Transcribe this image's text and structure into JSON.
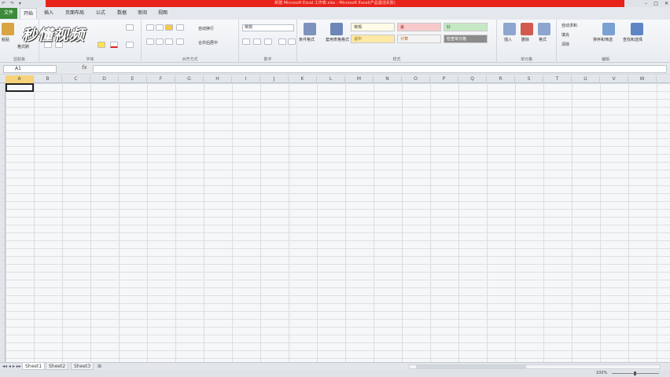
{
  "window": {
    "title": "新建 Microsoft Excel 工作表.xlsx - Microsoft Excel(产品激活失败)",
    "controls": [
      "–",
      "□",
      "✕"
    ]
  },
  "tabs": {
    "file": "文件",
    "items": [
      "开始",
      "插入",
      "页面布局",
      "公式",
      "数据",
      "审阅",
      "视图"
    ],
    "active": "开始"
  },
  "ribbon": {
    "clipboard": {
      "label": "剪贴板",
      "paste": "粘贴",
      "format_painter": "格式刷"
    },
    "font": {
      "label": "字体"
    },
    "alignment": {
      "label": "对齐方式",
      "wrap": "自动换行",
      "merge": "合并后居中"
    },
    "number": {
      "label": "数字",
      "format": "常规"
    },
    "styles": {
      "label": "样式",
      "conditional": "条件格式",
      "table_format": "套用表格格式",
      "cells": [
        {
          "name": "常规",
          "bg": "#fffbe6",
          "fg": "#333333"
        },
        {
          "name": "差",
          "bg": "#f8c9cb",
          "fg": "#9c2a2a"
        },
        {
          "name": "好",
          "bg": "#c6e8c4",
          "fg": "#2f6b2f"
        },
        {
          "name": "适中",
          "bg": "#ffe9a6",
          "fg": "#8a6a00"
        },
        {
          "name": "计算",
          "bg": "#f3f3f3",
          "fg": "#c45a00"
        },
        {
          "name": "检查单元格",
          "bg": "#8c8c8c",
          "fg": "#ffffff"
        }
      ]
    },
    "cells": {
      "label": "单元格",
      "insert": "插入",
      "delete": "删除",
      "format": "格式"
    },
    "editing": {
      "label": "编辑",
      "autosum": "自动求和",
      "fill": "填充",
      "clear": "清除",
      "sort": "排序和筛选",
      "find": "查找和选择"
    }
  },
  "watermark": "秒懂视频",
  "formula_bar": {
    "name_box": "A1",
    "fx": "fx",
    "value": ""
  },
  "grid": {
    "columns": [
      "A",
      "B",
      "C",
      "D",
      "E",
      "F",
      "G",
      "H",
      "I",
      "J",
      "K",
      "L",
      "M",
      "N",
      "O",
      "P",
      "Q",
      "R",
      "S",
      "T",
      "U",
      "V",
      "W"
    ],
    "selected_column": "A",
    "active_cell": "A1"
  },
  "sheets": {
    "items": [
      "Sheet1",
      "Sheet2",
      "Sheet3"
    ],
    "active": "Sheet1"
  },
  "status": {
    "zoom": "100%"
  }
}
